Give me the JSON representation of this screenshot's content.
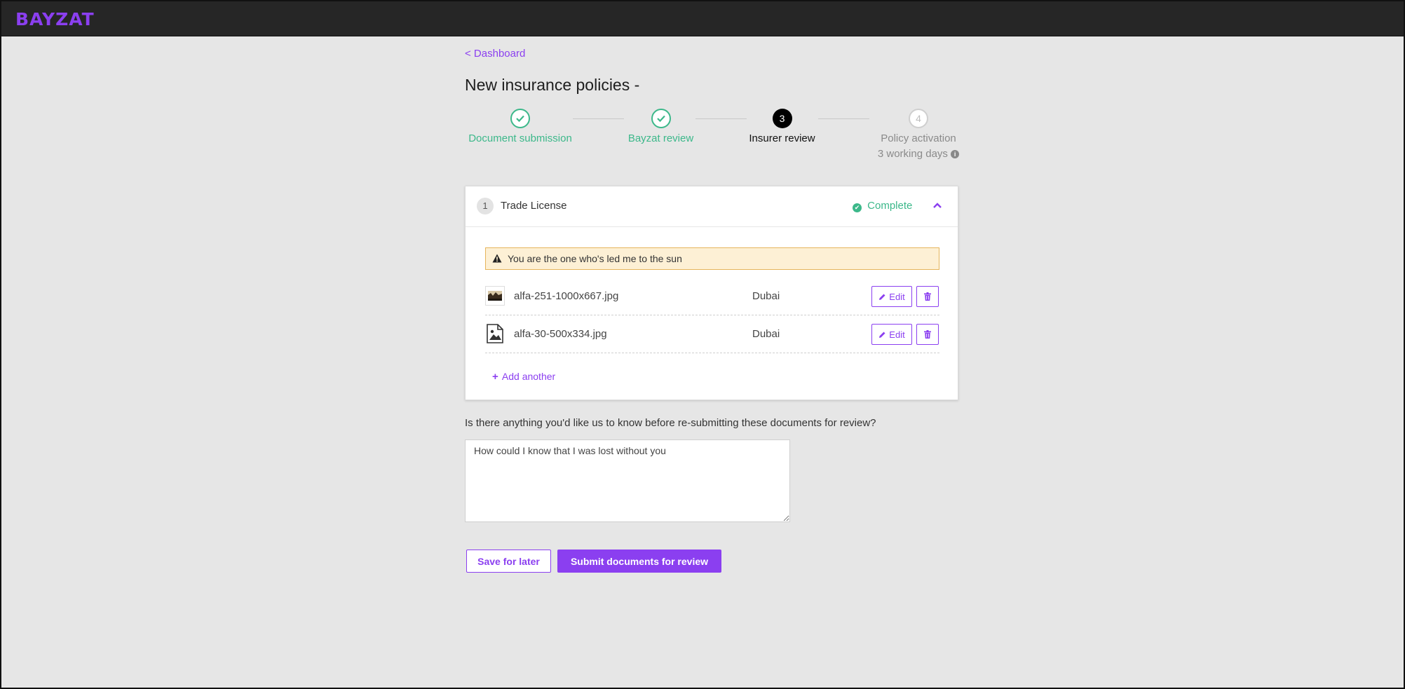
{
  "brand": {
    "logo_text": "BAYZAT",
    "accent_color": "#8b3ff0"
  },
  "nav": {
    "back_link": "< Dashboard"
  },
  "page": {
    "title": "New insurance policies -"
  },
  "stepper": {
    "steps": [
      {
        "number": "1",
        "label": "Document submission",
        "state": "complete"
      },
      {
        "number": "2",
        "label": "Bayzat review",
        "state": "complete"
      },
      {
        "number": "3",
        "label": "Insurer review",
        "state": "active"
      },
      {
        "number": "4",
        "label": "Policy activation",
        "sublabel": "3 working days",
        "state": "pending"
      }
    ],
    "complete_color": "#3cb88a"
  },
  "document_card": {
    "number": "1",
    "title": "Trade License",
    "status": "Complete",
    "warning": "You are the one who's led me to the sun",
    "files": [
      {
        "name": "alfa-251-1000x667.jpg",
        "location": "Dubai",
        "thumbnail_icon": "photo-thumbnail",
        "edit_label": "Edit"
      },
      {
        "name": "alfa-30-500x334.jpg",
        "location": "Dubai",
        "thumbnail_icon": "image-file-icon",
        "edit_label": "Edit"
      }
    ],
    "add_another": "Add another"
  },
  "notes": {
    "question": "Is there anything you'd like us to know before re-submitting these documents for review?",
    "value": "How could I know that I was lost without you"
  },
  "actions": {
    "save_label": "Save for later",
    "submit_label": "Submit documents for review"
  }
}
